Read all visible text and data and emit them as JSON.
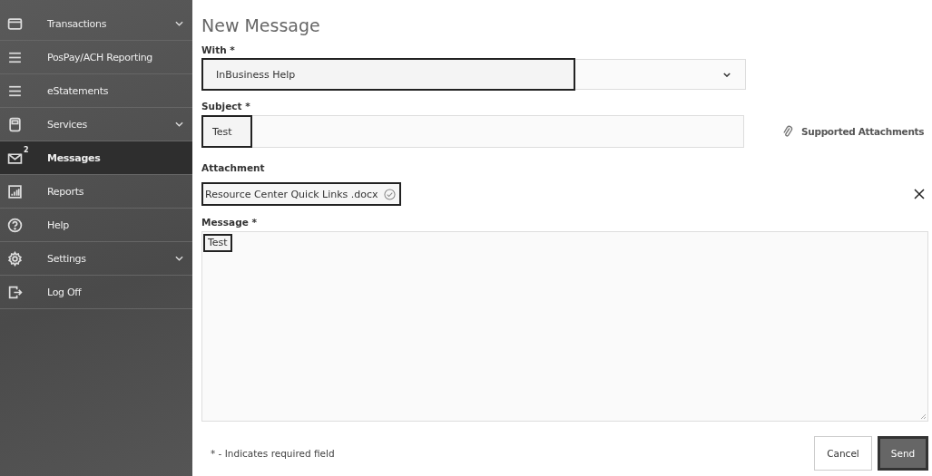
{
  "sidebar": {
    "items": [
      {
        "label": "Transactions",
        "expandable": true,
        "selected": false
      },
      {
        "label": "PosPay/ACH Reporting",
        "expandable": false,
        "selected": false
      },
      {
        "label": "eStatements",
        "expandable": false,
        "selected": false
      },
      {
        "label": "Services",
        "expandable": true,
        "selected": false
      },
      {
        "label": "Messages",
        "expandable": false,
        "selected": true,
        "badge": "2"
      },
      {
        "label": "Reports",
        "expandable": false,
        "selected": false
      },
      {
        "label": "Help",
        "expandable": false,
        "selected": false
      },
      {
        "label": "Settings",
        "expandable": true,
        "selected": false
      },
      {
        "label": "Log Off",
        "expandable": false,
        "selected": false
      }
    ]
  },
  "page_title": "New Message",
  "with": {
    "label": "With *",
    "value": "InBusiness Help"
  },
  "subject": {
    "label": "Subject *",
    "value": "Test"
  },
  "supported_attachments": "Supported Attachments",
  "attachment": {
    "label": "Attachment",
    "file": "Resource Center Quick Links .docx"
  },
  "message": {
    "label": "Message *",
    "value": "Test"
  },
  "required_note": "* - Indicates required field",
  "buttons": [
    {
      "label": "Cancel",
      "kind": "secondary"
    },
    {
      "label": "Send",
      "kind": "primary"
    }
  ]
}
